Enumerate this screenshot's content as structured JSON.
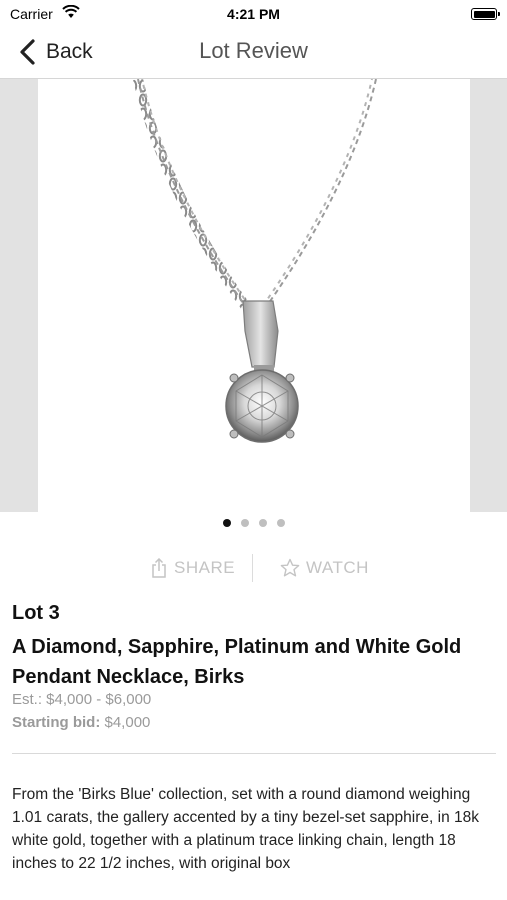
{
  "status_bar": {
    "carrier": "Carrier",
    "time": "4:21 PM"
  },
  "nav": {
    "back_label": "Back",
    "title": "Lot Review"
  },
  "gallery": {
    "page_count": 4,
    "active_index": 0
  },
  "actions": {
    "share_label": "SHARE",
    "watch_label": "WATCH"
  },
  "lot": {
    "number": "Lot 3",
    "title": "A Diamond, Sapphire, Platinum and White Gold Pendant Necklace, Birks",
    "estimate": "Est.: $4,000 - $6,000",
    "starting_bid_label": "Starting bid:",
    "starting_bid_value": "$4,000",
    "description": "From the 'Birks Blue' collection, set with a round diamond weighing 1.01 carats, the gallery accented by a tiny bezel-set sapphire, in 18k white gold, together with a platinum trace linking chain, length 18 inches to 22 1/2 inches, with original box"
  },
  "colors": {
    "accent_text": "#555555",
    "muted_text": "#9a9a9a",
    "action_text": "#c4c4c4"
  }
}
